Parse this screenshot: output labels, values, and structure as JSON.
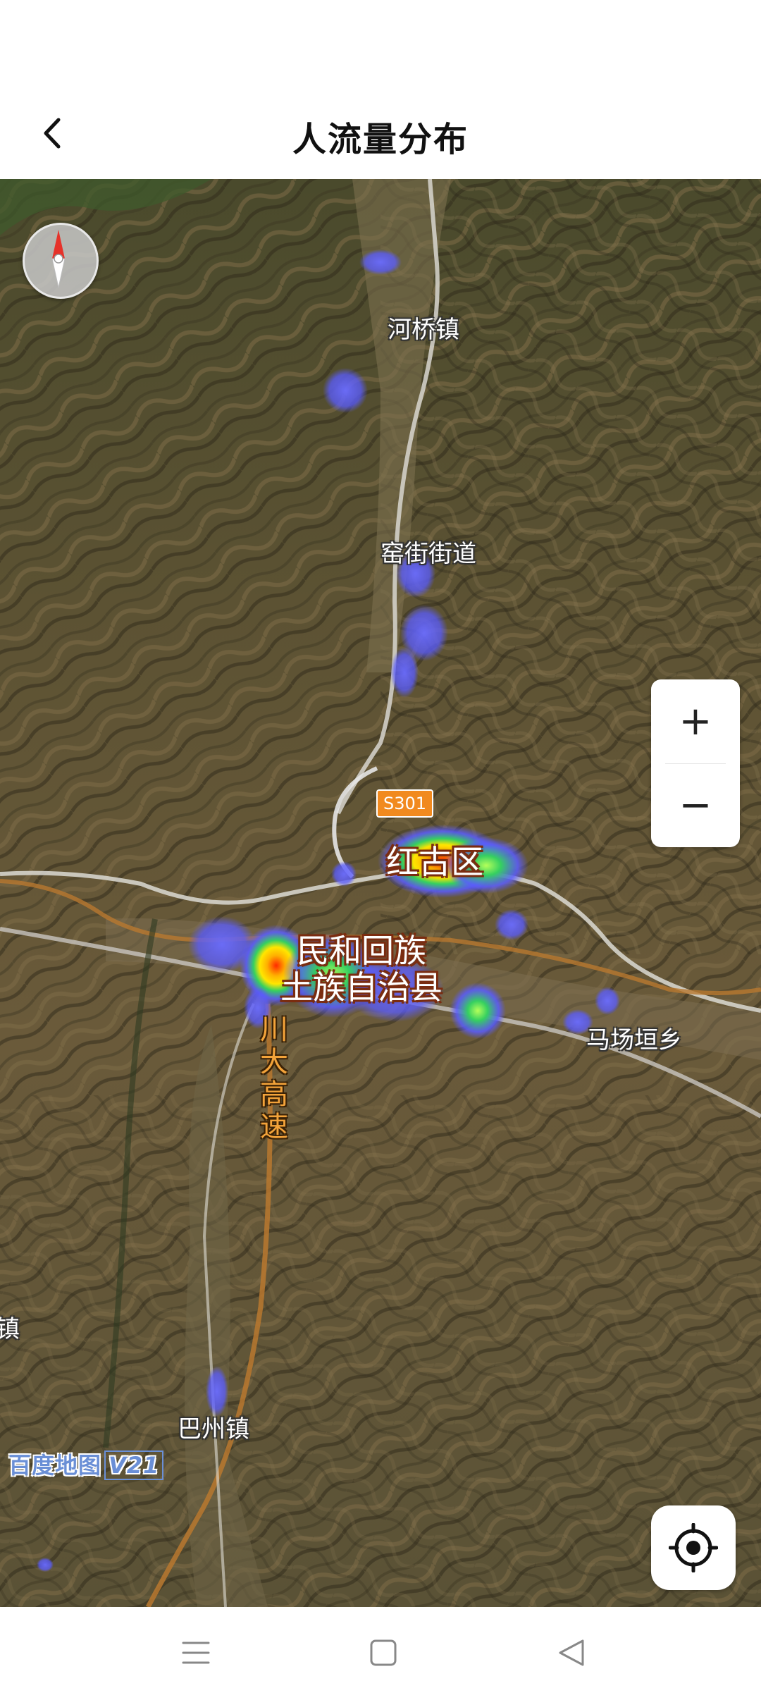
{
  "header": {
    "title": "人流量分布",
    "back_icon": "chevron-left-icon"
  },
  "map": {
    "places": {
      "heqiao": "河桥镇",
      "yaojie": "窑街街道",
      "honggu": "红古区",
      "minhe_line1": "民和回族",
      "minhe_line2": "土族自治县",
      "machang": "马场垣乡",
      "bazhou": "巴州镇",
      "left_edge": "镇"
    },
    "road_shield": "S301",
    "expressway": [
      "川",
      "大",
      "高",
      "速"
    ],
    "watermark": {
      "text": "百度地图",
      "version": "V21"
    },
    "heatmap_colors": {
      "low": "#5a5cff",
      "mid": "#35d060",
      "high": "#ffd400",
      "peak": "#ff2a00"
    }
  },
  "controls": {
    "compass_icon": "compass-icon",
    "zoom_in": "+",
    "zoom_out": "−",
    "locate_icon": "locate-icon"
  },
  "system_nav": {
    "menu_icon": "menu-icon",
    "home_icon": "home-square-icon",
    "back_icon": "back-triangle-icon"
  }
}
